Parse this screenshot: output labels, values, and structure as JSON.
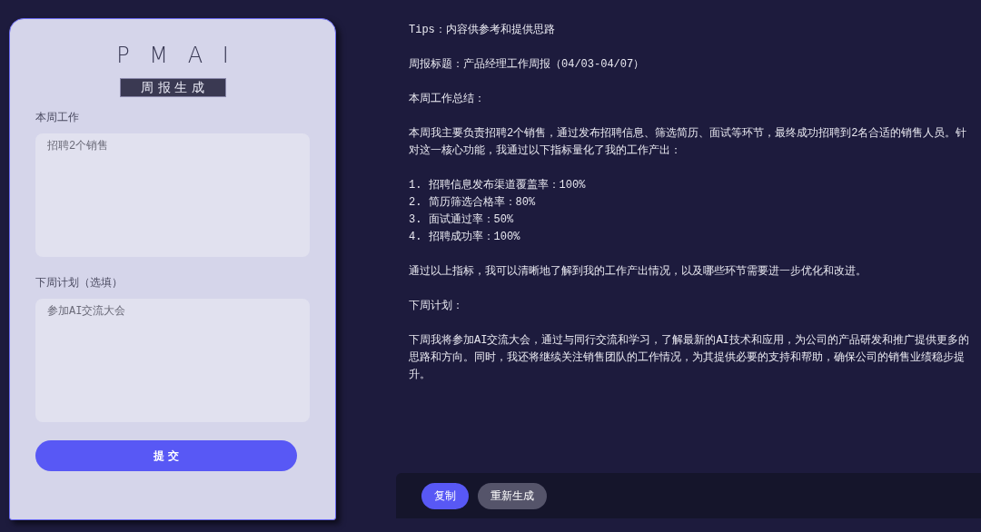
{
  "form": {
    "logo": "PMAI",
    "title": "周报生成",
    "fields": [
      {
        "label": "本周工作",
        "value": "招聘2个销售"
      },
      {
        "label": "下周计划（选填）",
        "value": "参加AI交流大会"
      }
    ],
    "submit": "提 交"
  },
  "output": {
    "blocks": [
      {
        "kind": "paragraph",
        "text": "Tips：内容供参考和提供思路"
      },
      {
        "kind": "paragraph",
        "text": "周报标题：产品经理工作周报（04/03-04/07）"
      },
      {
        "kind": "paragraph",
        "text": "本周工作总结："
      },
      {
        "kind": "paragraph",
        "text": "本周我主要负责招聘2个销售，通过发布招聘信息、筛选简历、面试等环节，最终成功招聘到2名合适的销售人员。针对这一核心功能，我通过以下指标量化了我的工作产出："
      },
      {
        "kind": "list",
        "items": [
          "1. 招聘信息发布渠道覆盖率：100%",
          "2. 简历筛选合格率：80%",
          "3. 面试通过率：50%",
          "4. 招聘成功率：100%"
        ]
      },
      {
        "kind": "paragraph",
        "text": "通过以上指标，我可以清晰地了解到我的工作产出情况，以及哪些环节需要进一步优化和改进。"
      },
      {
        "kind": "paragraph",
        "text": "下周计划："
      },
      {
        "kind": "paragraph",
        "text": "下周我将参加AI交流大会，通过与同行交流和学习，了解最新的AI技术和应用，为公司的产品研发和推广提供更多的思路和方向。同时，我还将继续关注销售团队的工作情况，为其提供必要的支持和帮助，确保公司的销售业绩稳步提升。"
      }
    ],
    "actions": [
      {
        "label": "复制",
        "kind": "primary"
      },
      {
        "label": "重新生成",
        "kind": "secondary"
      }
    ]
  }
}
